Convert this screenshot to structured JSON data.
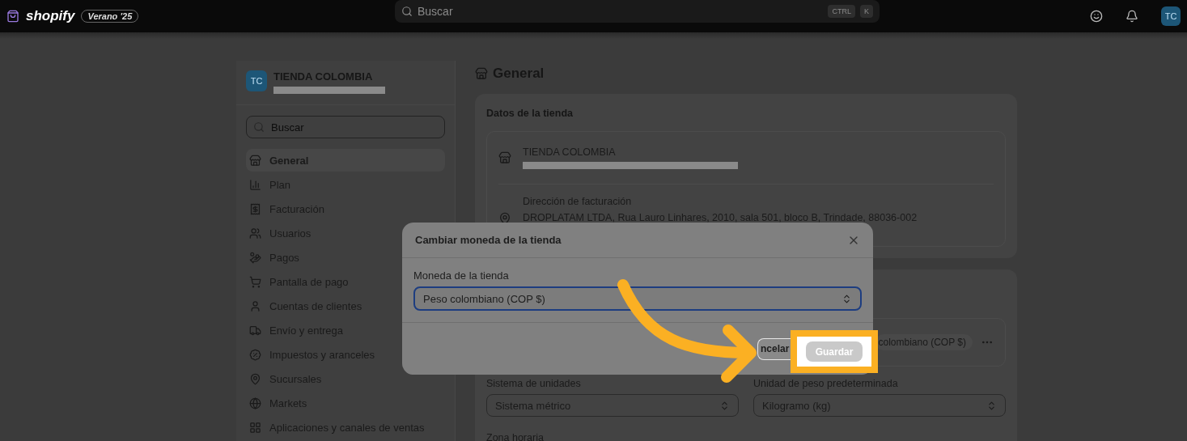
{
  "topbar": {
    "brand": "shopify",
    "badge": "Verano '25",
    "search": {
      "placeholder": "Buscar"
    },
    "keys": [
      "CTRL",
      "K"
    ],
    "avatar": "TC"
  },
  "sidebar": {
    "store": {
      "initials": "TC",
      "name": "TIENDA COLOMBIA"
    },
    "search": {
      "placeholder": "Buscar"
    },
    "items": [
      {
        "label": "General",
        "selected": true
      },
      {
        "label": "Plan",
        "selected": false
      },
      {
        "label": "Facturación",
        "selected": false
      },
      {
        "label": "Usuarios",
        "selected": false
      },
      {
        "label": "Pagos",
        "selected": false
      },
      {
        "label": "Pantalla de pago",
        "selected": false
      },
      {
        "label": "Cuentas de clientes",
        "selected": false
      },
      {
        "label": "Envío y entrega",
        "selected": false
      },
      {
        "label": "Impuestos y aranceles",
        "selected": false
      },
      {
        "label": "Sucursales",
        "selected": false
      },
      {
        "label": "Markets",
        "selected": false
      },
      {
        "label": "Aplicaciones y canales de ventas",
        "selected": false
      }
    ]
  },
  "page": {
    "title": "General",
    "store_details": {
      "title": "Datos de la tienda",
      "store_name": "TIENDA COLOMBIA",
      "billing_label": "Dirección de facturación",
      "billing_address": "DROPLATAM LTDA, Rua Lauro Linhares, 2010, sala 501, bloco B, Trindade, 88036-002"
    },
    "defaults": {
      "currency_pill": "colombiano (COP $)",
      "unit_system": {
        "label": "Sistema de unidades",
        "value": "Sistema métrico"
      },
      "weight_unit": {
        "label": "Unidad de peso predeterminada",
        "value": "Kilogramo (kg)"
      },
      "timezone_label": "Zona horaria"
    }
  },
  "modal": {
    "title": "Cambiar moneda de la tienda",
    "field_label": "Moneda de la tienda",
    "field_value": "Peso colombiano (COP $)",
    "cancel": "ncelar",
    "save": {
      "label": "Guardar",
      "disabled": true
    }
  }
}
